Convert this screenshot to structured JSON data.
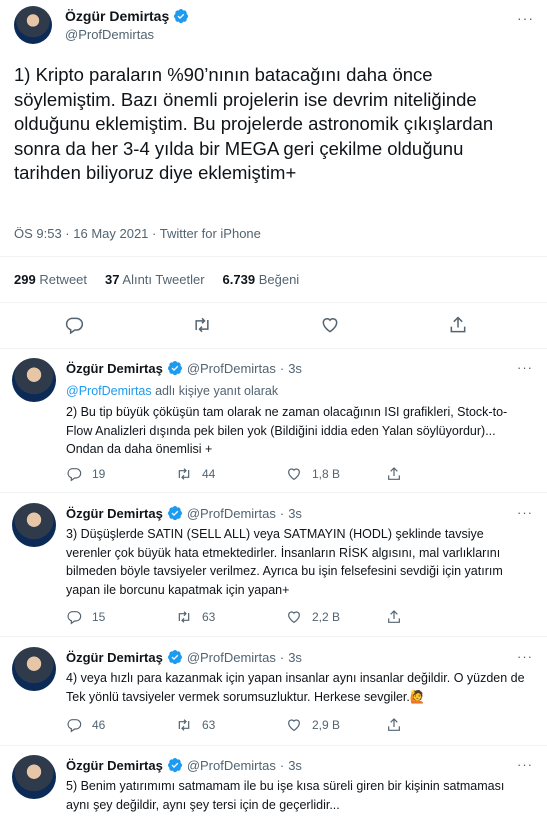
{
  "main_tweet": {
    "author_name": "Özgür Demirtaş",
    "author_handle": "@ProfDemirtas",
    "text": "1) Kripto paraların %90’nının batacağını daha önce söylemiştim. Bazı önemli projelerin ise devrim niteliğinde olduğunu eklemiştim. Bu projelerde astronomik çıkışlardan sonra da her 3-4 yılda bir MEGA geri çekilme olduğunu tarihden biliyoruz diye eklemiştim+",
    "meta": "ÖS 9:53 · 16 May 2021 · Twitter for iPhone",
    "stats": {
      "retweets_count": "299",
      "retweets_label": "Retweet",
      "quotes_count": "37",
      "quotes_label": "Alıntı Tweetler",
      "likes_count": "6.739",
      "likes_label": "Beğeni"
    }
  },
  "replies": [
    {
      "author_name": "Özgür Demirtaş",
      "author_handle": "@ProfDemirtas",
      "time": "3s",
      "replying_to_handle": "@ProfDemirtas",
      "replying_to_suffix": "adlı kişiye yanıt olarak",
      "text": "2) Bu tip büyük çöküşün tam olarak ne zaman olacağının ISI grafikleri, Stock-to-Flow Analizleri dışında pek bilen yok (Bildiğini iddia eden Yalan söylüyordur)... Ondan da daha önemlisi +",
      "reply_count": "19",
      "retweet_count": "44",
      "like_count": "",
      "view_count": "1,8 B"
    },
    {
      "author_name": "Özgür Demirtaş",
      "author_handle": "@ProfDemirtas",
      "time": "3s",
      "text": "3) Düşüşlerde SATIN (SELL ALL) veya SATMAYIN (HODL) şeklinde tavsiye verenler çok büyük hata etmektedirler. İnsanların RİSK algısını, mal varlıklarını bilmeden böyle tavsiyeler verilmez. Ayrıca bu işin felsefesini sevdiği için yatırım yapan ile borcunu kapatmak için yapan+",
      "reply_count": "15",
      "retweet_count": "63",
      "like_count": "",
      "view_count": "2,2 B"
    },
    {
      "author_name": "Özgür Demirtaş",
      "author_handle": "@ProfDemirtas",
      "time": "3s",
      "text": "4) veya hızlı para kazanmak için yapan insanlar aynı insanlar değildir. O yüzden de Tek yönlü tavsiyeler vermek sorumsuzluktur. Herkese sevgiler.🙋",
      "reply_count": "46",
      "retweet_count": "63",
      "like_count": "",
      "view_count": "2,9 B"
    },
    {
      "author_name": "Özgür Demirtaş",
      "author_handle": "@ProfDemirtas",
      "time": "3s",
      "text": "5) Benim yatırımımı satmamam ile bu işe kısa süreli giren bir kişinin satmaması aynı şey değildir, aynı şey tersi için de geçerlidir..."
    }
  ],
  "icons": {
    "verified": "verified-badge-icon",
    "reply": "reply-icon",
    "retweet": "retweet-icon",
    "like": "heart-icon",
    "share": "share-icon",
    "more": "more-icon"
  },
  "colors": {
    "accent": "#1d9bf0",
    "text": "#0f1419",
    "muted": "#536471",
    "border": "#eff3f4"
  },
  "more_glyph": "···"
}
